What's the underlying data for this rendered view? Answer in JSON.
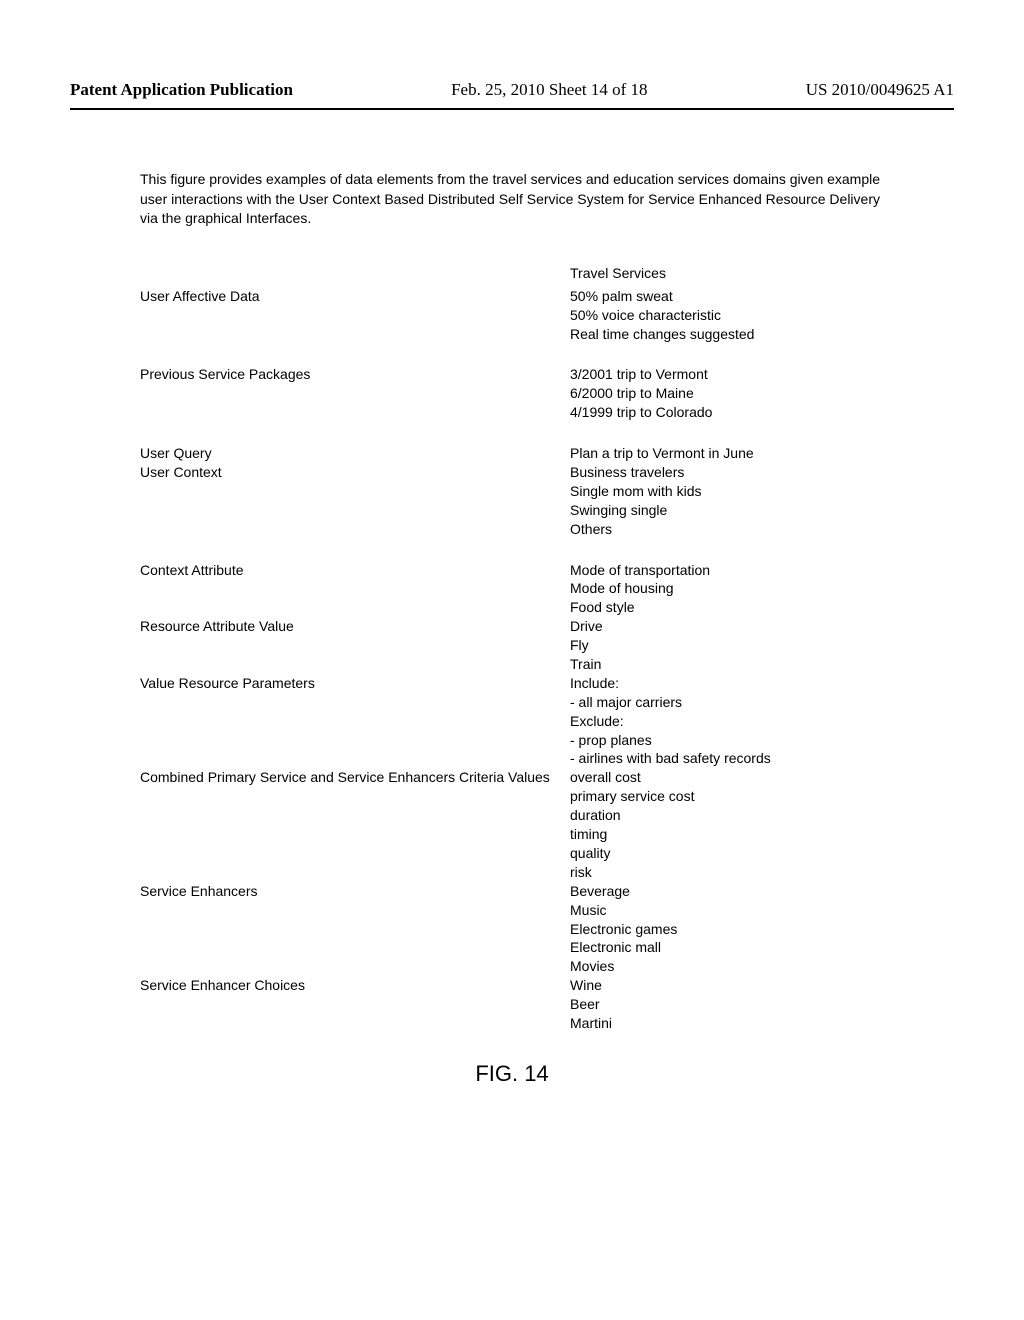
{
  "header": {
    "left": "Patent Application Publication",
    "center": "Feb. 25, 2010  Sheet 14 of 18",
    "right": "US 2010/0049625 A1"
  },
  "intro": "This figure provides examples of data elements from the travel services and education services domains given example user interactions with the User Context Based Distributed Self Service System for Service Enhanced Resource Delivery via the graphical Interfaces.",
  "columnHeader": "Travel Services",
  "sections": [
    {
      "label": "User Affective Data",
      "values": [
        "50% palm sweat",
        "50% voice characteristic",
        "Real time changes suggested"
      ]
    },
    {
      "gap": true
    },
    {
      "label": "Previous Service Packages",
      "values": [
        "3/2001 trip to Vermont",
        "6/2000 trip to Maine",
        "4/1999 trip to Colorado"
      ]
    },
    {
      "gap": true
    },
    {
      "label": "User Query",
      "values": [
        "Plan a trip to Vermont in June"
      ]
    },
    {
      "label": "User Context",
      "values": [
        "Business travelers",
        "Single mom with kids",
        "Swinging single",
        "Others"
      ]
    },
    {
      "gap": true
    },
    {
      "label": "Context Attribute",
      "values": [
        "Mode of transportation",
        "Mode of housing",
        "Food style"
      ]
    },
    {
      "label": "Resource Attribute Value",
      "values": [
        "Drive",
        "Fly",
        "Train"
      ]
    },
    {
      "label": "Value Resource Parameters",
      "values": [
        "Include:",
        "- all major carriers",
        "Exclude:",
        "- prop planes",
        "- airlines with bad safety records"
      ]
    },
    {
      "label": "Combined Primary Service and Service Enhancers Criteria Values",
      "values": [
        "overall cost",
        "primary service cost",
        "duration",
        "timing",
        "quality",
        "risk"
      ]
    },
    {
      "label": "Service Enhancers",
      "values": [
        "Beverage",
        "Music",
        "Electronic games",
        "Electronic mall",
        "Movies"
      ]
    },
    {
      "label": "Service Enhancer Choices",
      "values": [
        "Wine",
        "Beer",
        "Martini"
      ]
    }
  ],
  "figureLabel": "FIG. 14"
}
